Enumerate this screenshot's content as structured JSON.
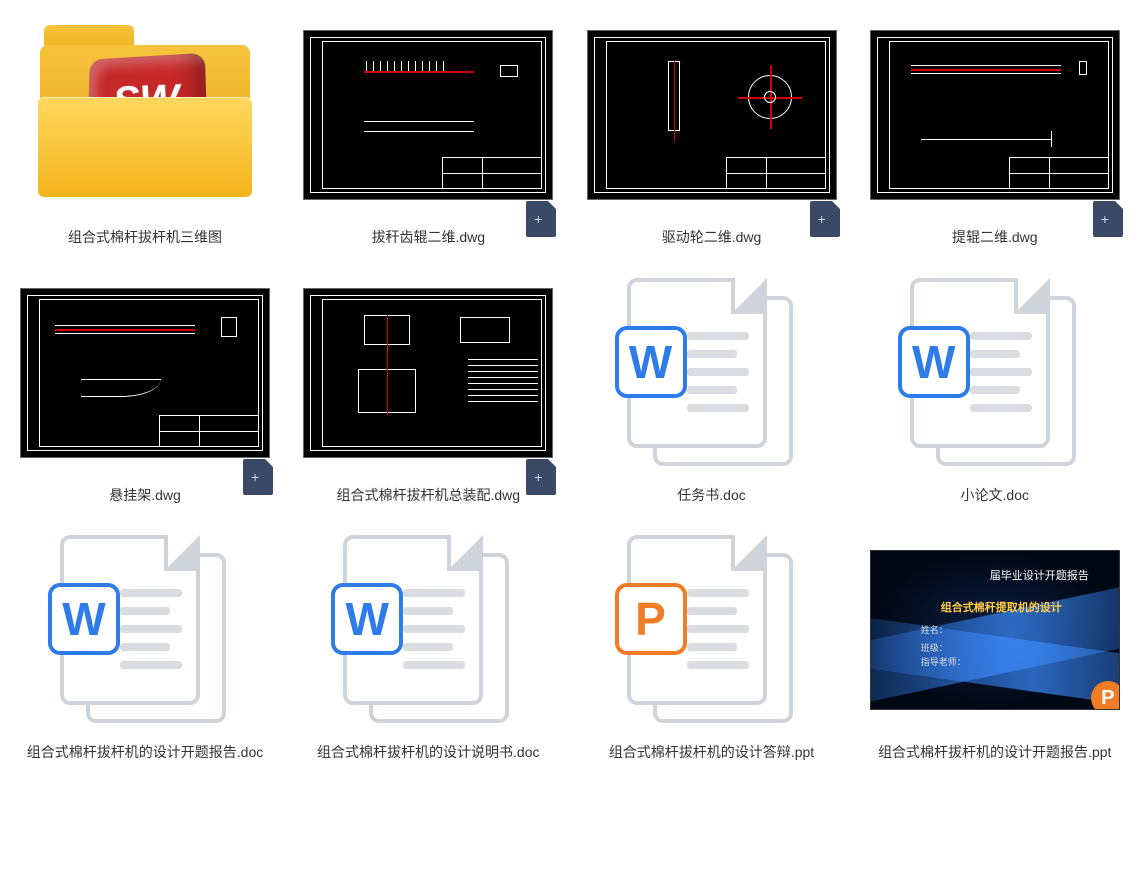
{
  "items": [
    {
      "label": "组合式棉杆拔杆机三维图",
      "type": "folder"
    },
    {
      "label": "拔秆齿辊二维.dwg",
      "type": "dwg",
      "variant": "roller"
    },
    {
      "label": "驱动轮二维.dwg",
      "type": "dwg",
      "variant": "wheel"
    },
    {
      "label": "提辊二维.dwg",
      "type": "dwg",
      "variant": "lift"
    },
    {
      "label": "悬挂架.dwg",
      "type": "dwg",
      "variant": "frame"
    },
    {
      "label": "组合式棉杆拔杆机总装配.dwg",
      "type": "dwg",
      "variant": "asm"
    },
    {
      "label": "任务书.doc",
      "type": "doc"
    },
    {
      "label": "小论文.doc",
      "type": "doc"
    },
    {
      "label": "组合式棉杆拔杆机的设计开题报告.doc",
      "type": "doc"
    },
    {
      "label": "组合式棉杆拔杆机的设计说明书.doc",
      "type": "doc"
    },
    {
      "label": "组合式棉杆拔杆机的设计答辩.ppt",
      "type": "ppt-icon"
    },
    {
      "label": "组合式棉杆拔杆机的设计开题报告.ppt",
      "type": "ppt-slide"
    }
  ],
  "ppt_slide": {
    "title": "届毕业设计开题报告",
    "subtitle": "组合式棉秆提取机的设计",
    "line1": "姓名：",
    "line2": "班级：",
    "line3": "指导老师："
  },
  "icons": {
    "w": "W",
    "p": "P",
    "sw": "SW"
  }
}
